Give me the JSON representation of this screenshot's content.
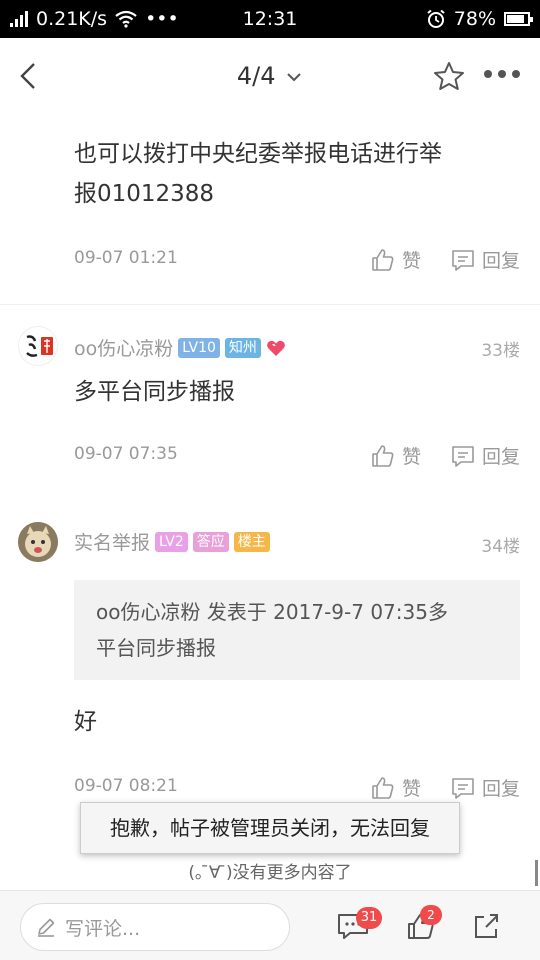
{
  "status_bar": {
    "speed": "0.21K/s",
    "dots": "•••",
    "time": "12:31",
    "battery": "78%"
  },
  "header": {
    "page_indicator": "4/4"
  },
  "post_top": {
    "text_line1": "也可以拨打中央纪委举报电话进行举",
    "text_line2": "报01012388",
    "time": "09-07 01:21",
    "like_label": "赞",
    "reply_label": "回复"
  },
  "comment_33": {
    "username": "oo伤心凉粉",
    "badges": [
      {
        "label": "LV10",
        "color": "#7fb3e8"
      },
      {
        "label": "知州",
        "color": "#6cb4e4"
      }
    ],
    "floor": "33楼",
    "text": "多平台同步播报",
    "time": "09-07 07:35",
    "like_label": "赞",
    "reply_label": "回复"
  },
  "comment_34": {
    "username": "实名举报",
    "badges": [
      {
        "label": "LV2",
        "color": "#e9a0e6"
      },
      {
        "label": "答应",
        "color": "#e7a0d8"
      },
      {
        "label": "楼主",
        "color": "#f5b748"
      }
    ],
    "floor": "34楼",
    "quote_line1": "oo伤心凉粉 发表于 2017-9-7 07:35多",
    "quote_line2": "平台同步播报",
    "text": "好",
    "time": "09-07 08:21",
    "like_label": "赞",
    "reply_label": "回复"
  },
  "toast": "抱歉，帖子被管理员关闭，无法回复",
  "no_more": "(｡ ̄∀ ̄)没有更多内容了",
  "bottom_bar": {
    "comment_placeholder": "写评论...",
    "comment_count": "31",
    "like_count": "2"
  },
  "colors": {
    "heart": "#f04a6a",
    "badge_red": "#f04a4a"
  }
}
